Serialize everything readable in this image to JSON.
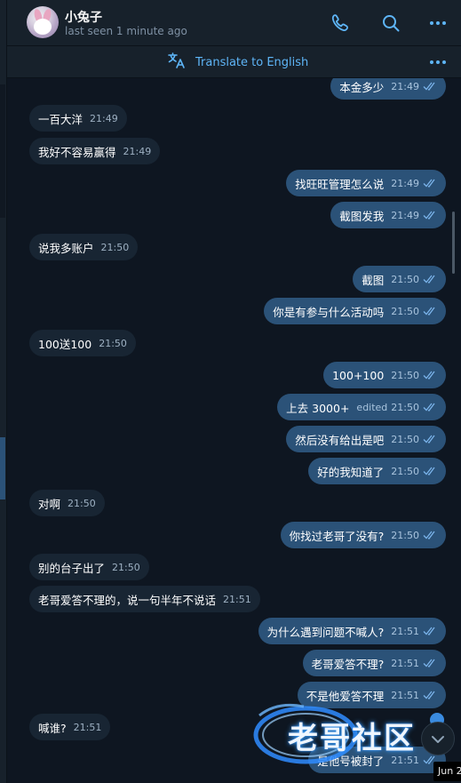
{
  "header": {
    "contact_name": "小兔子",
    "status": "last seen 1 minute ago",
    "icons": [
      "phone-icon",
      "search-icon",
      "more-icon"
    ]
  },
  "translate_bar": {
    "label": "Translate to English",
    "icon": "translate-icon"
  },
  "colors": {
    "background": "#0e1621",
    "panel": "#17212b",
    "incoming_bubble": "#182533",
    "outgoing_bubble": "#2b5278",
    "accent": "#5eb5f7"
  },
  "messages": [
    {
      "dir": "out",
      "text": "本金多少",
      "time": "21:49"
    },
    {
      "dir": "in",
      "text": "一百大洋",
      "time": "21:49"
    },
    {
      "dir": "in",
      "text": "我好不容易赢得",
      "time": "21:49"
    },
    {
      "dir": "out",
      "text": "找旺旺管理怎么说",
      "time": "21:49"
    },
    {
      "dir": "out",
      "text": "截图发我",
      "time": "21:49"
    },
    {
      "dir": "in",
      "text": "说我多账户",
      "time": "21:50"
    },
    {
      "dir": "out",
      "text": "截图",
      "time": "21:50"
    },
    {
      "dir": "out",
      "text": "你是有参与什么活动吗",
      "time": "21:50"
    },
    {
      "dir": "in",
      "text": "100送100",
      "time": "21:50"
    },
    {
      "dir": "out",
      "text": "100+100",
      "time": "21:50"
    },
    {
      "dir": "out",
      "text": "上去 3000+",
      "time": "21:50",
      "edited": "edited"
    },
    {
      "dir": "out",
      "text": "然后没有给出是吧",
      "time": "21:50"
    },
    {
      "dir": "out",
      "text": "好的我知道了",
      "time": "21:50"
    },
    {
      "dir": "in",
      "text": "对啊",
      "time": "21:50"
    },
    {
      "dir": "out",
      "text": "你找过老哥了没有?",
      "time": "21:50"
    },
    {
      "dir": "in",
      "text": "别的台子出了",
      "time": "21:50"
    },
    {
      "dir": "in",
      "text": "老哥爱答不理的，说一句半年不说话",
      "time": "21:51"
    },
    {
      "dir": "out",
      "text": "为什么遇到问题不喊人?",
      "time": "21:51"
    },
    {
      "dir": "out",
      "text": "老哥爱答不理?",
      "time": "21:51"
    },
    {
      "dir": "out",
      "text": "不是他爱答不理",
      "time": "21:51"
    },
    {
      "dir": "in",
      "text": "喊谁?",
      "time": "21:51"
    },
    {
      "dir": "out",
      "text": "是他号被封了",
      "time": "21:51"
    }
  ],
  "watermark": {
    "text": "老哥社区"
  },
  "date_tooltip": "Jun 2"
}
